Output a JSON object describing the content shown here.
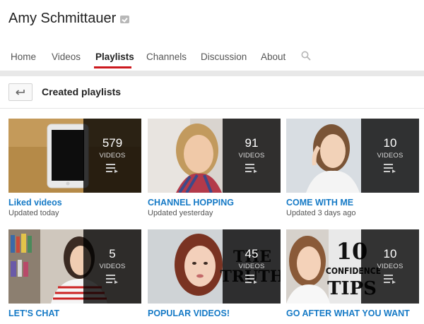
{
  "channel": {
    "name": "Amy Schmittauer"
  },
  "tabs": [
    {
      "label": "Home"
    },
    {
      "label": "Videos"
    },
    {
      "label": "Playlists"
    },
    {
      "label": "Channels"
    },
    {
      "label": "Discussion"
    },
    {
      "label": "About"
    }
  ],
  "active_tab": "Playlists",
  "section": {
    "title": "Created playlists"
  },
  "playlists": [
    {
      "title": "Liked videos",
      "updated": "Updated today",
      "count": "579",
      "count_label": "VIDEOS"
    },
    {
      "title": "CHANNEL HOPPING",
      "updated": "Updated yesterday",
      "count": "91",
      "count_label": "VIDEOS"
    },
    {
      "title": "COME WITH ME",
      "updated": "Updated 3 days ago",
      "count": "10",
      "count_label": "VIDEOS"
    },
    {
      "title": "LET'S CHAT",
      "updated": "",
      "count": "5",
      "count_label": "VIDEOS"
    },
    {
      "title": "POPULAR VIDEOS!",
      "updated": "",
      "count": "45",
      "count_label": "VIDEOS",
      "thumb_text": "THE TRUTH"
    },
    {
      "title": "GO AFTER WHAT YOU WANT",
      "updated": "",
      "count": "10",
      "count_label": "VIDEOS",
      "thumb_text_big": "10",
      "thumb_text_mid": "CONFIDENCE",
      "thumb_text_low": "TIPS"
    }
  ],
  "colors": {
    "link": "#167ac6",
    "accent": "#cc181e"
  },
  "icons": {
    "verified": "verified-check-icon",
    "search": "search-icon",
    "back": "back-arrow-icon",
    "playlist": "playlist-icon"
  }
}
